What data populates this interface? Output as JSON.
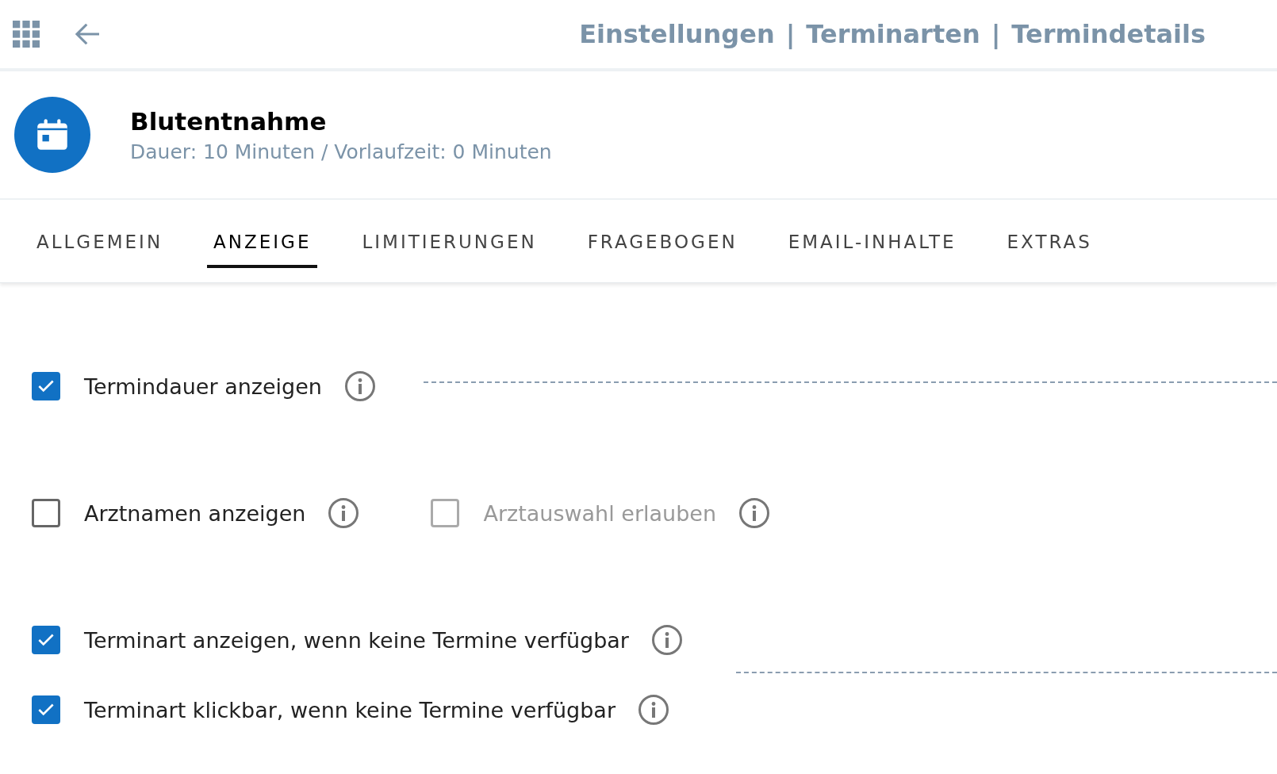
{
  "breadcrumb": {
    "items": [
      "Einstellungen",
      "Terminarten",
      "Termindetails"
    ],
    "separator": "|"
  },
  "appointment_type": {
    "title": "Blutentnahme",
    "subtitle": "Dauer: 10 Minuten / Vorlaufzeit: 0 Minuten"
  },
  "tabs": [
    {
      "label": "ALLGEMEIN",
      "selected": false
    },
    {
      "label": "ANZEIGE",
      "selected": true
    },
    {
      "label": "LIMITIERUNGEN",
      "selected": false
    },
    {
      "label": "FRAGEBOGEN",
      "selected": false
    },
    {
      "label": "EMAIL-INHALTE",
      "selected": false
    },
    {
      "label": "EXTRAS",
      "selected": false
    }
  ],
  "settings": [
    {
      "options": [
        {
          "label": "Termindauer anzeigen",
          "checked": true,
          "disabled": false
        }
      ],
      "dashed_line_beside": true,
      "dashed_line_below": false
    },
    {
      "options": [
        {
          "label": "Arztnamen anzeigen",
          "checked": false,
          "disabled": false
        },
        {
          "label": "Arztauswahl erlauben",
          "checked": false,
          "disabled": true
        }
      ],
      "dashed_line_beside": false,
      "dashed_line_below": false
    },
    {
      "options": [
        {
          "label": "Terminart anzeigen, wenn keine Termine verfügbar",
          "checked": true,
          "disabled": false
        }
      ],
      "dashed_line_beside": false,
      "dashed_line_below": true
    },
    {
      "options": [
        {
          "label": "Terminart klickbar, wenn keine Termine verfügbar",
          "checked": true,
          "disabled": false
        }
      ],
      "dashed_line_beside": false,
      "dashed_line_below": false
    }
  ]
}
